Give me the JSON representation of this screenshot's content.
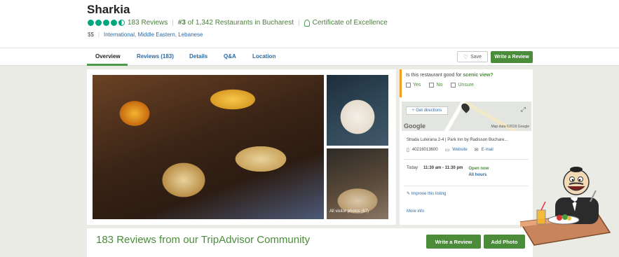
{
  "header": {
    "title": "Sharkia",
    "reviews": "183 Reviews",
    "rank_num": "#3",
    "rank_rest": " of 1,342 Restaurants in Bucharest",
    "certificate": "Certificate of Excellence",
    "price": "$$",
    "cuisines": "International, Middle Eastern, Lebanese"
  },
  "tabs": [
    {
      "label": "Overview"
    },
    {
      "label": "Reviews (183)"
    },
    {
      "label": "Details"
    },
    {
      "label": "Q&A"
    },
    {
      "label": "Location"
    }
  ],
  "actions": {
    "save": "Save",
    "write_review": "Write a Review"
  },
  "photos": {
    "all_label": "All visitor photos (67)"
  },
  "scenic": {
    "question_prefix": "Is this restaurant good for ",
    "question_keyword": "scenic view?",
    "options": [
      "Yes",
      "No",
      "Unsure"
    ]
  },
  "map": {
    "directions": "Get directions",
    "google": "Google",
    "mapdata": "Map data ©2016 Google"
  },
  "location": {
    "address": "Strada Luterana 2-4 | Park Inn by Radisson Buchare...",
    "phone": "40216013600",
    "website": "Website",
    "email": "E-mail"
  },
  "hours": {
    "day": "Today",
    "time": "11:30 am - 11:30 pm",
    "status": "Open now",
    "all": "All hours"
  },
  "links": {
    "improve": "Improve this listing",
    "more": "More info"
  },
  "reviews_section": {
    "title": "183 Reviews from our TripAdvisor Community",
    "write": "Write a Review",
    "add_photo": "Add Photo"
  },
  "colors": {
    "accent_green": "#4a8c3a",
    "link_blue": "#2d6aa3",
    "bubble_green": "#00a680",
    "scenic_orange": "#f59d1b"
  }
}
